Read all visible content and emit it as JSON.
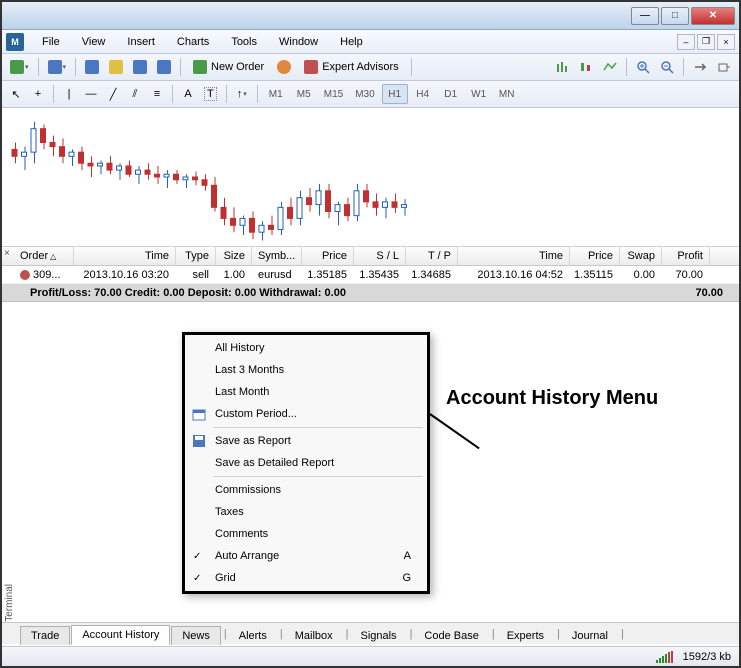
{
  "menubar": {
    "items": [
      "File",
      "View",
      "Insert",
      "Charts",
      "Tools",
      "Window",
      "Help"
    ]
  },
  "toolbar1": {
    "new_order": "New Order",
    "expert_advisors": "Expert Advisors"
  },
  "toolbar2": {
    "timeframes": [
      "M1",
      "M5",
      "M15",
      "M30",
      "H1",
      "H4",
      "D1",
      "W1",
      "MN"
    ],
    "active_tf": "H1",
    "letter_a": "A",
    "letter_t": "T"
  },
  "grid": {
    "headers": {
      "order": "Order",
      "time1": "Time",
      "type": "Type",
      "size": "Size",
      "symbol": "Symb...",
      "price1": "Price",
      "sl": "S / L",
      "tp": "T / P",
      "time2": "Time",
      "price2": "Price",
      "swap": "Swap",
      "profit": "Profit"
    },
    "row": {
      "order": "309...",
      "time1": "2013.10.16 03:20",
      "type": "sell",
      "size": "1.00",
      "symbol": "eurusd",
      "price1": "1.35185",
      "sl": "1.35435",
      "tp": "1.34685",
      "time2": "2013.10.16 04:52",
      "price2": "1.35115",
      "swap": "0.00",
      "profit": "70.00"
    },
    "summary": {
      "text": "Profit/Loss: 70.00  Credit: 0.00  Deposit: 0.00  Withdrawal: 0.00",
      "total": "70.00"
    }
  },
  "context_menu": {
    "all_history": "All History",
    "last_3_months": "Last 3 Months",
    "last_month": "Last Month",
    "custom_period": "Custom Period...",
    "save_report": "Save as Report",
    "save_detailed": "Save as Detailed Report",
    "commissions": "Commissions",
    "taxes": "Taxes",
    "comments": "Comments",
    "auto_arrange": "Auto Arrange",
    "auto_arrange_key": "A",
    "grid": "Grid",
    "grid_key": "G"
  },
  "annotation": "Account History Menu",
  "terminal_label": "Terminal",
  "bottom_tabs": [
    "Trade",
    "Account History",
    "News",
    "Alerts",
    "Mailbox",
    "Signals",
    "Code Base",
    "Experts",
    "Journal"
  ],
  "active_tab": "Account History",
  "statusbar": {
    "transfer": "1592/3 kb"
  },
  "chart_data": {
    "type": "candlestick",
    "note": "approximate candlestick positions read from pixels; no axis labels present",
    "candles_approx_count": 48,
    "color_up": "#2060c0",
    "color_down": "#c03030"
  }
}
